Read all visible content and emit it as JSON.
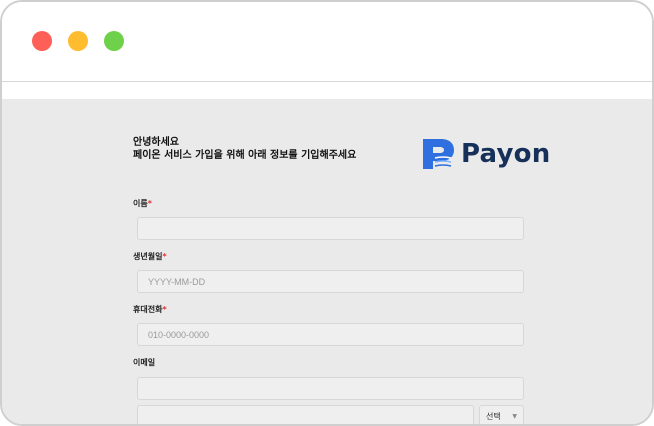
{
  "window": {
    "controls": {
      "close_color": "#fe5f57",
      "minimize_color": "#febc2e",
      "maximize_color": "#6fd04a"
    }
  },
  "greeting": {
    "line1": "안녕하세요",
    "line2": "페이온 서비스 가입을 위해 아래 정보를 기입해주세요"
  },
  "logo": {
    "text": "Payon",
    "icon": "payon-logo-icon",
    "brand_color": "#2f6fe0",
    "text_color": "#16305a"
  },
  "form": {
    "name": {
      "label": "이름",
      "required_mark": "*",
      "value": "",
      "placeholder": ""
    },
    "birthdate": {
      "label": "생년월일",
      "required_mark": "*",
      "value": "",
      "placeholder": "YYYY-MM-DD"
    },
    "phone": {
      "label": "휴대전화",
      "required_mark": "*",
      "value": "",
      "placeholder": "010-0000-0000"
    },
    "email": {
      "label": "이메일",
      "value": "",
      "placeholder": "",
      "domain_value": "",
      "domain_select": "선택"
    }
  },
  "colors": {
    "required": "#e03131",
    "content_bg": "#eaeaea"
  }
}
